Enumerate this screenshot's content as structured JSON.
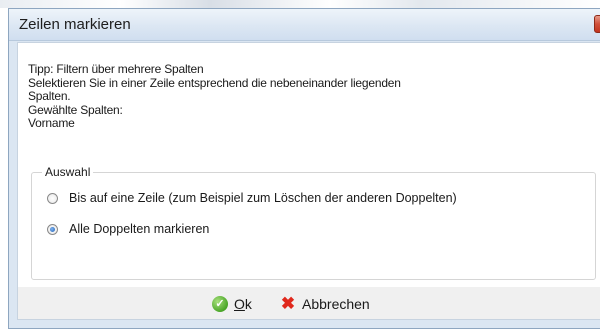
{
  "dialog": {
    "title": "Zeilen markieren",
    "close_glyph": "x",
    "info_lines": [
      "Tipp: Filtern über mehrere Spalten",
      "Selektieren Sie in einer Zeile entsprechend die nebeneinander liegenden",
      "Spalten.",
      "Gewählte Spalten:",
      "Vorname"
    ],
    "group": {
      "label": "Auswahl",
      "options": [
        {
          "label": "Bis auf eine Zeile (zum Beispiel zum Löschen der anderen Doppelten)",
          "checked": false
        },
        {
          "label": "Alle Doppelten markieren",
          "checked": true
        }
      ]
    },
    "buttons": {
      "ok_accel": "O",
      "ok_rest": "k",
      "cancel_label": "Abbrechen"
    }
  },
  "icons": {
    "ok": "check-circle-icon",
    "cancel": "red-x-icon",
    "close": "close-icon"
  },
  "colors": {
    "accent": "#1f5fb4",
    "ok_icon": "#4aa628",
    "cancel_icon": "#e0281c",
    "close_button": "#c2341e"
  }
}
